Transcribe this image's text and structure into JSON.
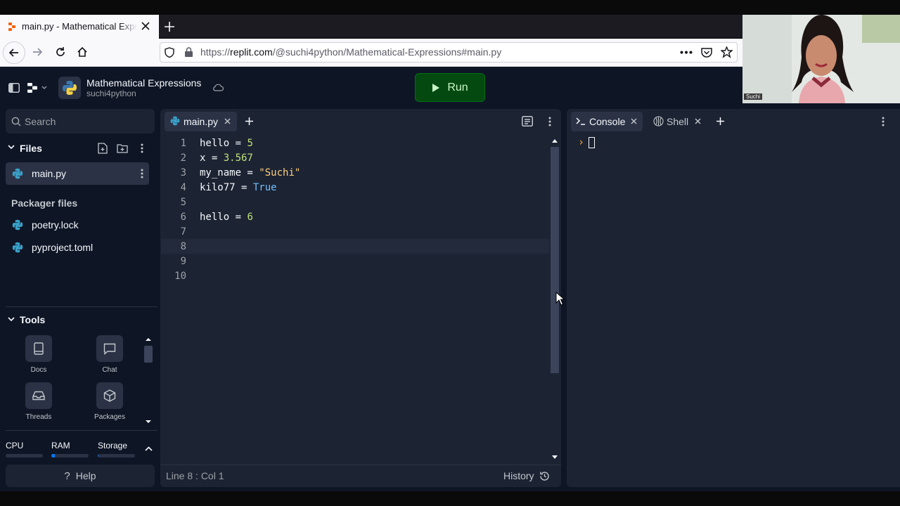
{
  "browser": {
    "tab_title": "main.py - Mathematical Expressions",
    "url_domain": "replit.com",
    "url_prefix": "https://",
    "url_path": "/@suchi4python/Mathematical-Expressions#main.py",
    "new_tab_label": "+"
  },
  "app": {
    "project_title": "Mathematical Expressions",
    "project_owner": "suchi4python",
    "run_label": "Run"
  },
  "sidebar": {
    "search_placeholder": "Search",
    "files_header": "Files",
    "files": [
      {
        "name": "main.py"
      }
    ],
    "packager_header": "Packager files",
    "packager_files": [
      {
        "name": "poetry.lock"
      },
      {
        "name": "pyproject.toml"
      }
    ],
    "tools_header": "Tools",
    "tools": [
      {
        "label": "Docs",
        "icon": "book-icon"
      },
      {
        "label": "Chat",
        "icon": "chat-icon"
      },
      {
        "label": "Threads",
        "icon": "inbox-icon"
      },
      {
        "label": "Packages",
        "icon": "box-icon"
      }
    ],
    "resources": {
      "cpu_label": "CPU",
      "cpu_level": 0.0,
      "ram_label": "RAM",
      "ram_level": 0.1,
      "storage_label": "Storage",
      "storage_level": 0.02
    },
    "help_label": "Help"
  },
  "editor": {
    "tab_label": "main.py",
    "line_numbers": [
      "1",
      "2",
      "3",
      "4",
      "5",
      "6",
      "7",
      "8",
      "9",
      "10"
    ],
    "lines": [
      {
        "a": "hello = ",
        "b": "5",
        "kind": "num"
      },
      {
        "a": "x = ",
        "b": "3.567",
        "kind": "num"
      },
      {
        "a": "my_name = ",
        "b": "\"Suchi\"",
        "kind": "str"
      },
      {
        "a": "kilo77 = ",
        "b": "True",
        "kind": "kw"
      },
      {
        "a": "",
        "b": "",
        "kind": ""
      },
      {
        "a": "hello = ",
        "b": "6",
        "kind": "num"
      },
      {
        "a": "",
        "b": "",
        "kind": ""
      },
      {
        "a": "",
        "b": "",
        "kind": ""
      },
      {
        "a": "",
        "b": "",
        "kind": ""
      },
      {
        "a": "",
        "b": "",
        "kind": ""
      }
    ],
    "status_position": "Line 8 : Col 1",
    "history_label": "History"
  },
  "console": {
    "tab_console": "Console",
    "tab_shell": "Shell",
    "prompt": "›"
  },
  "webcam": {
    "name_tag": "Suchi"
  }
}
